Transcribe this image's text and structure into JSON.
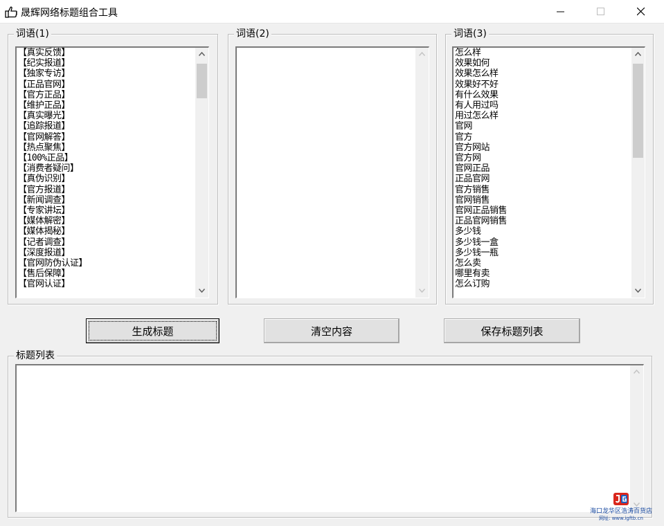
{
  "window": {
    "title": "晟辉网络标题组合工具",
    "icon": "pointing-hand-icon",
    "controls": [
      "minimize-icon",
      "maximize-icon",
      "close-icon"
    ]
  },
  "groups": {
    "words1": {
      "label": "词语(1)",
      "items": [
        "【真实反馈】",
        "【纪实报道】",
        "【独家专访】",
        "【正品官网】",
        "【官方正品】",
        "【维护正品】",
        "【真实曝光】",
        "【追踪报道】",
        "【官网解答】",
        "【热点聚焦】",
        "【100%正品】",
        "【消费者疑问】",
        "【真伪识别】",
        "【官方报道】",
        "【新闻调查】",
        "【专家讲坛】",
        "【媒体解密】",
        "【媒体揭秘】",
        "【记者调查】",
        "【深度报道】",
        "【官网防伪认证】",
        "【售后保障】",
        "【官网认证】"
      ]
    },
    "words2": {
      "label": "词语(2)",
      "items": []
    },
    "words3": {
      "label": "词语(3)",
      "items": [
        "怎么样",
        "效果如何",
        "效果怎么样",
        "效果好不好",
        "有什么效果",
        "有人用过吗",
        "用过怎么样",
        "官网",
        "官方",
        "官方网站",
        "官方网",
        "官网正品",
        "正品官网",
        "官方销售",
        "官网销售",
        "官网正品销售",
        "正品官网销售",
        "多少钱",
        "多少钱一盒",
        "多少钱一瓶",
        "怎么卖",
        "哪里有卖",
        "怎么订购"
      ]
    }
  },
  "buttons": {
    "generate": "生成标题",
    "clear": "清空内容",
    "save": "保存标题列表"
  },
  "title_list": {
    "label": "标题列表",
    "items": []
  },
  "watermark": {
    "logo": "jg-logo-icon",
    "line1": "海口龙华区浩涛百货店",
    "line2": "网址: www.igftb.cn"
  },
  "colors": {
    "window_bg": "#f0f0f0",
    "watermark_text": "#1a4aa0",
    "logo_red": "#d9261c",
    "logo_blue": "#1f5fbf"
  }
}
